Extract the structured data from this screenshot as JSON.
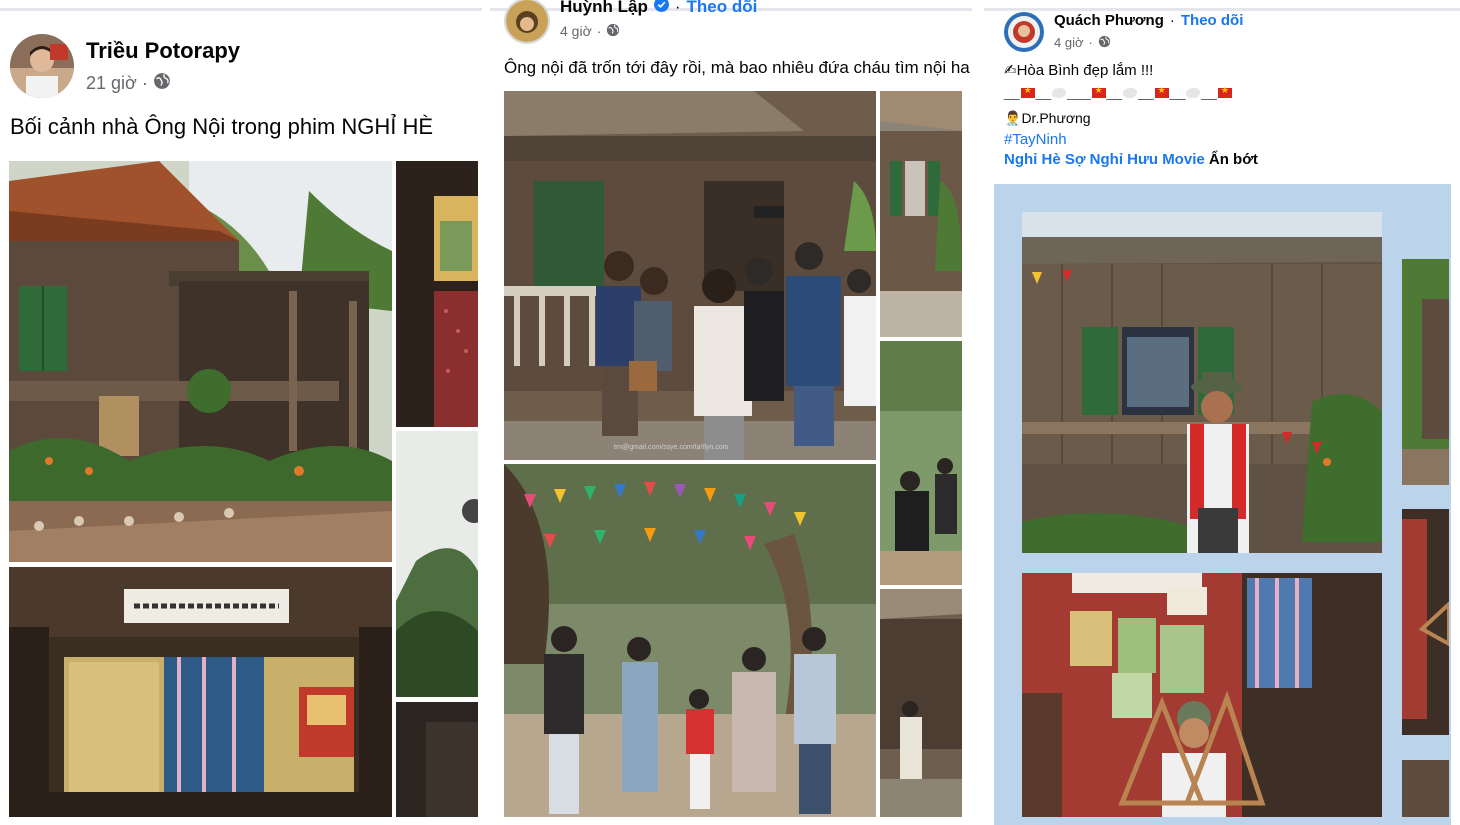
{
  "post1": {
    "author": "Triều Potorapy",
    "time": "21 giờ",
    "caption": "Bối cảnh nhà Ông Nội trong phim NGHỈ HÈ",
    "privacy_icon": "globe-icon"
  },
  "post2": {
    "author": "Huỳnh Lập",
    "follow": "Theo dõi",
    "time": "4 giờ",
    "caption": "Ông nội đã trốn tới đây rồi, mà bao nhiêu đứa cháu tìm nội ha",
    "privacy_icon": "globe-icon"
  },
  "post3": {
    "author": "Quách Phương",
    "follow": "Theo dõi",
    "time": "4 giờ",
    "line1": "Hòa Bình đẹp lắm !!!",
    "signature": "Dr.Phương",
    "hashtag": "#TayNinh",
    "movie_link": "Nghỉ Hè Sợ Nghỉ Hưu Movie",
    "see_less": "Ẩn bớt",
    "privacy_icon": "globe-icon"
  },
  "colors": {
    "link_blue": "#1877f2",
    "meta_gray": "#65676b",
    "album_bg": "#bcd3ec"
  },
  "photos": {
    "p2_watermark": "trn@gmail.com/ssye.com/ta/tlyn.com"
  }
}
